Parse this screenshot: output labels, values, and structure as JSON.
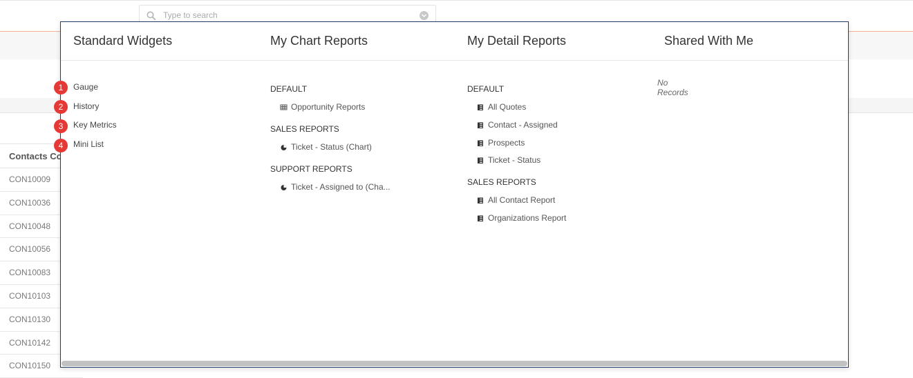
{
  "search": {
    "placeholder": "Type to search"
  },
  "table": {
    "header": "Contacts Co",
    "rows": [
      "CON10009",
      "CON10036",
      "CON10048",
      "CON10056",
      "CON10083",
      "CON10103",
      "CON10130",
      "CON10142",
      "CON10150"
    ]
  },
  "panel": {
    "columns": {
      "standard_widgets": {
        "title": "Standard Widgets",
        "items": [
          {
            "num": "1",
            "label": "Gauge"
          },
          {
            "num": "2",
            "label": "History"
          },
          {
            "num": "3",
            "label": "Key Metrics"
          },
          {
            "num": "4",
            "label": "Mini List"
          }
        ]
      },
      "chart_reports": {
        "title": "My Chart Reports",
        "sections": [
          {
            "label": "DEFAULT",
            "items": [
              {
                "label": "Opportunity Reports",
                "icon": "table-icon"
              }
            ]
          },
          {
            "label": "SALES REPORTS",
            "items": [
              {
                "label": "Ticket - Status (Chart)",
                "icon": "pie-chart-icon"
              }
            ]
          },
          {
            "label": "SUPPORT REPORTS",
            "items": [
              {
                "label": "Ticket - Assigned to (Cha...",
                "icon": "pie-chart-icon"
              }
            ]
          }
        ]
      },
      "detail_reports": {
        "title": "My Detail Reports",
        "sections": [
          {
            "label": "DEFAULT",
            "items": [
              {
                "label": "All Quotes",
                "icon": "report-icon"
              },
              {
                "label": "Contact - Assigned",
                "icon": "report-icon"
              },
              {
                "label": "Prospects",
                "icon": "report-icon"
              },
              {
                "label": "Ticket - Status",
                "icon": "report-icon"
              }
            ]
          },
          {
            "label": "SALES REPORTS",
            "items": [
              {
                "label": "All Contact Report",
                "icon": "report-icon"
              },
              {
                "label": "Organizations Report",
                "icon": "report-icon"
              }
            ]
          }
        ]
      },
      "shared": {
        "title": "Shared With Me",
        "empty_text": "No Records"
      }
    }
  },
  "colors": {
    "panel_border": "#223a66",
    "badge": "#e53935",
    "accent_line": "#f0b49a"
  }
}
